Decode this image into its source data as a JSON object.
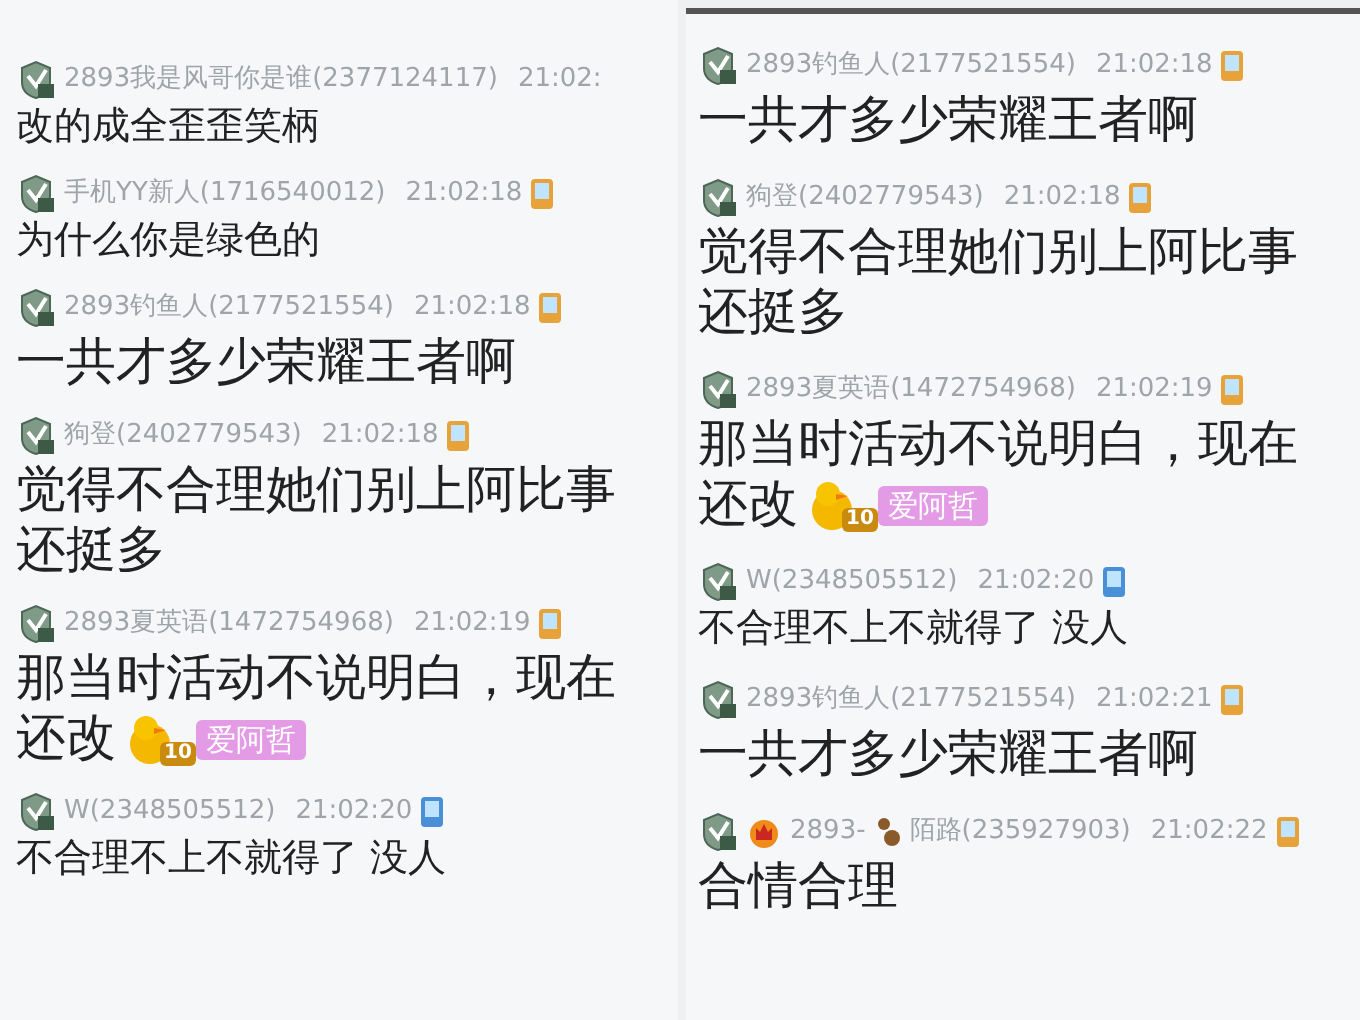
{
  "panels": [
    {
      "messages": [
        {
          "sender": [
            "2893我是风哥你是谁(2377124117)"
          ],
          "time": "21:02:",
          "crown": false,
          "kind": "small",
          "text": "改的成全歪歪笑柄"
        },
        {
          "sender": [
            "手机YY新人(1716540012)"
          ],
          "time": "21:02:18",
          "crown": false,
          "device": {
            "color": "#e8a23a"
          },
          "kind": "small",
          "text": "为什么你是绿色的"
        },
        {
          "sender": [
            "2893钓鱼人(2177521554)"
          ],
          "time": "21:02:18",
          "crown": false,
          "device": {
            "color": "#e8a23a"
          },
          "kind": "large",
          "text": "一共才多少荣耀王者啊"
        },
        {
          "sender": [
            "狗登(2402779543)"
          ],
          "time": "21:02:18",
          "crown": false,
          "device": {
            "color": "#e8a23a"
          },
          "kind": "large",
          "text": "觉得不合理她们别上阿比事还挺多"
        },
        {
          "sender": [
            "2893夏英语(1472754968)"
          ],
          "time": "21:02:19",
          "crown": false,
          "device": {
            "color": "#e8a23a"
          },
          "kind": "large",
          "text": "那当时活动不说明白，现在还改",
          "badge": {
            "rank": "10",
            "label": "爱阿哲"
          }
        },
        {
          "sender": [
            "W(2348505512)"
          ],
          "time": "21:02:20",
          "crown": false,
          "device": {
            "color": "#4a90d9"
          },
          "kind": "small",
          "text": "不合理不上不就得了 没人"
        }
      ]
    },
    {
      "messages": [
        {
          "sender": [
            "2893钓鱼人(2177521554)"
          ],
          "time": "21:02:18",
          "crown": false,
          "device": {
            "color": "#e8a23a"
          },
          "kind": "large",
          "text": "一共才多少荣耀王者啊"
        },
        {
          "sender": [
            "狗登(2402779543)"
          ],
          "time": "21:02:18",
          "crown": false,
          "device": {
            "color": "#e8a23a"
          },
          "kind": "large",
          "text": "觉得不合理她们别上阿比事还挺多"
        },
        {
          "sender": [
            "2893夏英语(1472754968)"
          ],
          "time": "21:02:19",
          "crown": false,
          "device": {
            "color": "#e8a23a"
          },
          "kind": "large",
          "text": "那当时活动不说明白，现在还改",
          "badge": {
            "rank": "10",
            "label": "爱阿哲"
          }
        },
        {
          "sender": [
            "W(2348505512)"
          ],
          "time": "21:02:20",
          "crown": false,
          "device": {
            "color": "#4a90d9"
          },
          "kind": "small",
          "text": "不合理不上不就得了 没人"
        },
        {
          "sender": [
            "2893钓鱼人(2177521554)"
          ],
          "time": "21:02:21",
          "crown": false,
          "device": {
            "color": "#e8a23a"
          },
          "kind": "large",
          "text": "一共才多少荣耀王者啊"
        },
        {
          "sender": [
            "2893-",
            "陌路(235927903)"
          ],
          "time": "21:02:22",
          "crown": true,
          "device": {
            "color": "#e8a23a"
          },
          "kind": "large",
          "text": "合情合理"
        }
      ]
    }
  ]
}
